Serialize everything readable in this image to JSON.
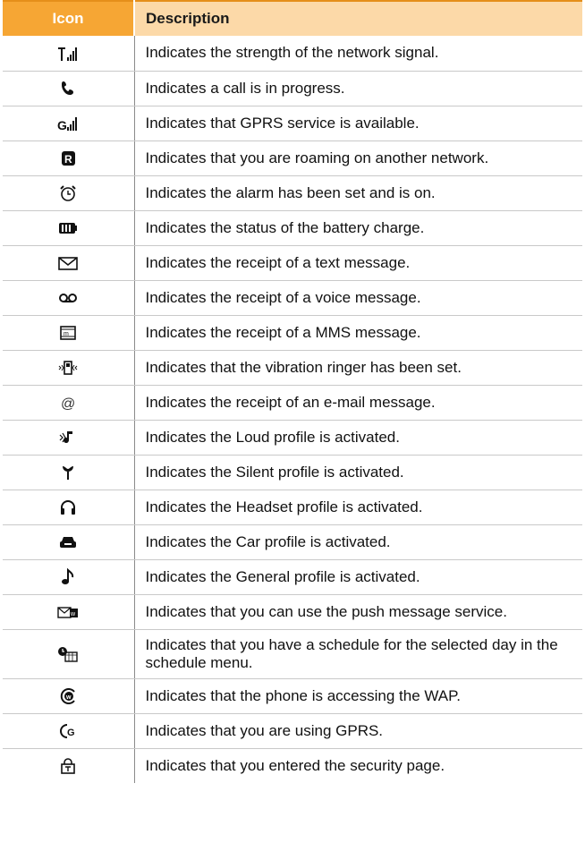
{
  "header": {
    "icon_label": "Icon",
    "description_label": "Description"
  },
  "rows": [
    {
      "icon": "signal-strength-icon",
      "description": "Indicates the strength of the network signal."
    },
    {
      "icon": "call-in-progress-icon",
      "description": "Indicates a call is in progress."
    },
    {
      "icon": "gprs-signal-icon",
      "description": "Indicates that GPRS service is available."
    },
    {
      "icon": "roaming-icon",
      "description": "Indicates that you are roaming on another network."
    },
    {
      "icon": "alarm-clock-icon",
      "description": "Indicates the alarm has been set and is on."
    },
    {
      "icon": "battery-icon",
      "description": "Indicates the status of the battery charge."
    },
    {
      "icon": "text-message-icon",
      "description": "Indicates the receipt of a text message."
    },
    {
      "icon": "voicemail-icon",
      "description": "Indicates the receipt of a voice message."
    },
    {
      "icon": "mms-icon",
      "description": "Indicates the receipt of a MMS message."
    },
    {
      "icon": "vibration-icon",
      "description": "Indicates that the vibration ringer has been set."
    },
    {
      "icon": "email-icon",
      "description": "Indicates the receipt of an e-mail message."
    },
    {
      "icon": "loud-profile-icon",
      "description": "Indicates the Loud profile is activated."
    },
    {
      "icon": "silent-profile-icon",
      "description": "Indicates the Silent profile is activated."
    },
    {
      "icon": "headset-profile-icon",
      "description": "Indicates the Headset profile is activated."
    },
    {
      "icon": "car-profile-icon",
      "description": "Indicates the Car profile is activated."
    },
    {
      "icon": "general-profile-icon",
      "description": "Indicates the General profile is activated."
    },
    {
      "icon": "push-message-icon",
      "description": "Indicates that you can use the push message service."
    },
    {
      "icon": "schedule-icon",
      "description": "Indicates that you have a schedule for the selected day in the schedule menu."
    },
    {
      "icon": "wap-icon",
      "description": "Indicates that the phone is accessing the WAP."
    },
    {
      "icon": "gprs-in-use-icon",
      "description": "Indicates that you are using GPRS."
    },
    {
      "icon": "security-page-icon",
      "description": "Indicates that you entered the security page."
    }
  ],
  "colors": {
    "header_icon_bg": "#f6a634",
    "header_desc_bg": "#fcd9a8",
    "header_rule": "#e58f1a",
    "row_rule": "#c9c9c9"
  }
}
